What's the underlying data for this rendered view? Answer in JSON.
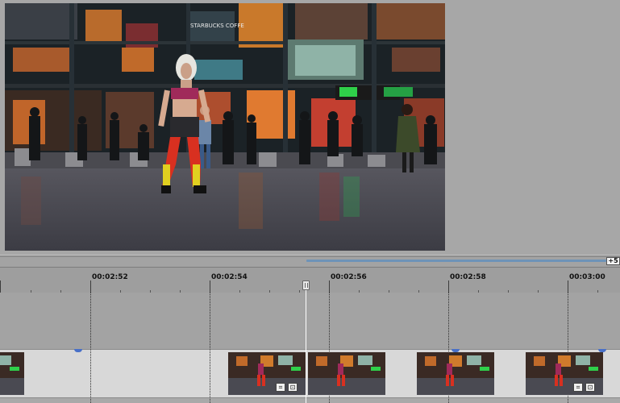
{
  "timeline": {
    "timecodes": [
      "00:02:52",
      "00:02:54",
      "00:02:56",
      "00:02:58",
      "00:03:00"
    ],
    "zoom_label": "+5"
  },
  "preview": {
    "storefront_sign": "STARBUCKS COFFE"
  },
  "effect_icons": {
    "crop_icon": "⌗",
    "fx_icon": "⊡"
  },
  "colors": {
    "accent": "#6e93b8",
    "playhead": "#ffffff",
    "fade_marker": "#4870c8"
  }
}
